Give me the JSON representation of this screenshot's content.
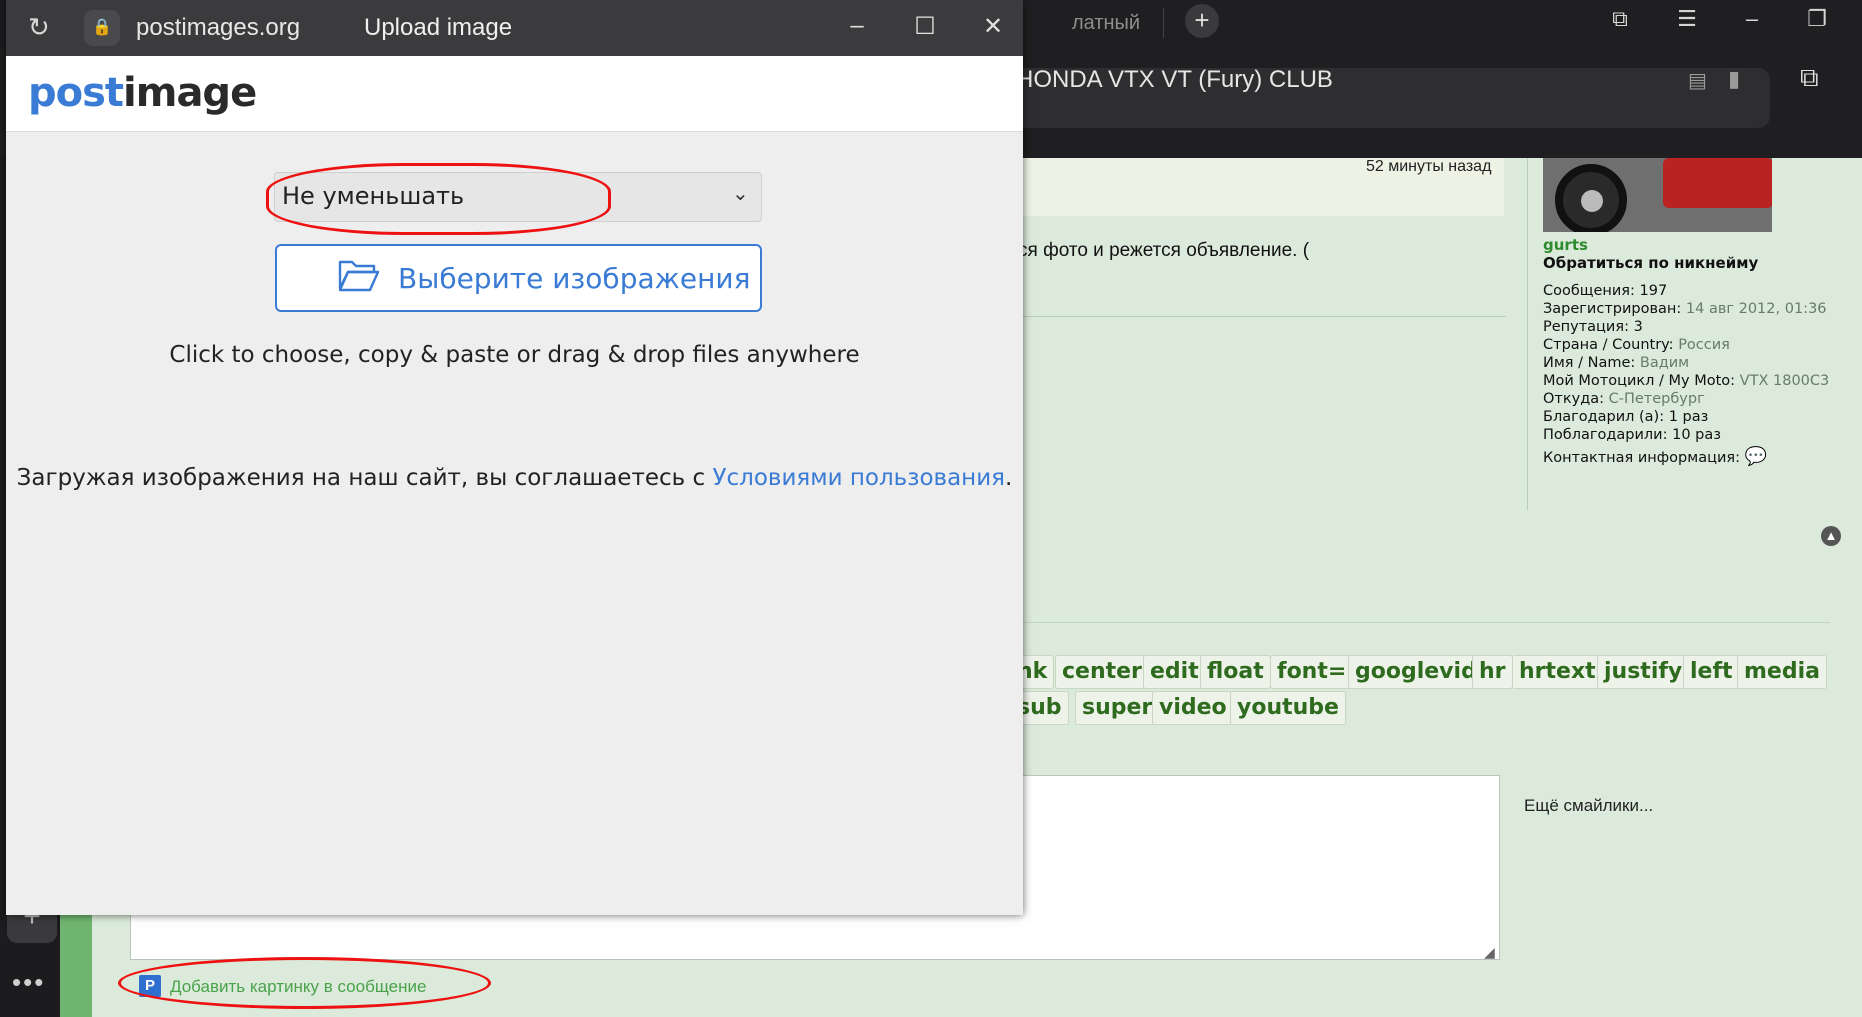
{
  "browser": {
    "tab_fragment": "латный",
    "window_controls": [
      "bookmarks-icon",
      "menu-icon",
      "minimize-icon",
      "restore-icon"
    ],
    "page_title": "HONDA VTX VT (Fury) CLUB"
  },
  "forum": {
    "time_ago": "52 минуты назад",
    "post_snippet": "ся фото и режется объявление. (",
    "profile": {
      "username": "gurts",
      "cta": "Обратиться по никнейму",
      "rows": [
        {
          "label": "Сообщения:",
          "value": "197"
        },
        {
          "label": "Зарегистрирован:",
          "value": "14 авг 2012, 01:36"
        },
        {
          "label": "Репутация:",
          "value": "3"
        },
        {
          "label": "Страна / Country:",
          "value": "Россия"
        },
        {
          "label": "Имя / Name:",
          "value": "Вадим"
        },
        {
          "label": "Мой Мотоцикл / My Moto:",
          "value": "VTX 1800C3"
        },
        {
          "label": "Откуда:",
          "value": "С-Петербург"
        },
        {
          "label": "Благодарил (а):",
          "value": "1 раз"
        },
        {
          "label": "Поблагодарили:",
          "value": "10 раз"
        },
        {
          "label": "Контактная информация:",
          "value": ""
        }
      ]
    },
    "bbcode_row1": [
      "nk",
      "center",
      "edit",
      "float",
      "font=",
      "googlevid",
      "hr",
      "hrtext",
      "justify",
      "left",
      "media"
    ],
    "bbcode_row2": [
      "sub",
      "super",
      "video",
      "youtube"
    ],
    "more_smilies": "Ещё смайлики...",
    "add_image_link": "Добавить картинку в сообщение"
  },
  "popup": {
    "domain": "postimages.org",
    "title": "Upload image",
    "logo_part1": "post",
    "logo_part2": "image",
    "resize_option": "Не уменьшать",
    "choose_button": "Выберите изображения",
    "hint": "Click to choose, copy & paste or drag & drop files anywhere",
    "terms_prefix": "Загружая изображения на наш сайт, вы соглашаетесь с ",
    "terms_link": "Условиями пользования",
    "terms_suffix": ".",
    "accent_color": "#3a7bd5"
  },
  "annotation_color": "#e11111"
}
